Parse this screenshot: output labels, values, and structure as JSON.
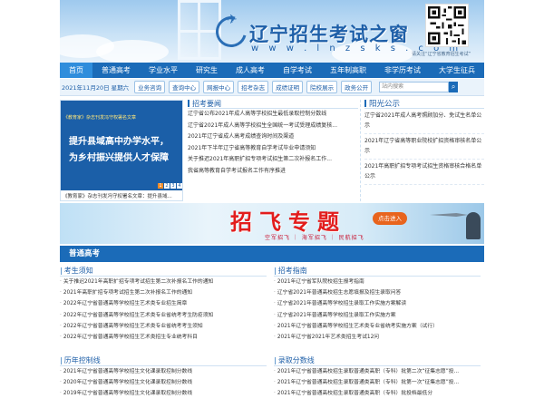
{
  "header": {
    "site_title": "辽宁招生考试之窗",
    "site_url": "w w w . l n z s k s . c o m",
    "qr_caption": "请关注“辽宁省教育招生考试”"
  },
  "main_nav": [
    "首页",
    "普通高考",
    "学业水平",
    "研究生",
    "成人高考",
    "自学考试",
    "五年制高职",
    "非学历考试",
    "大学生征兵"
  ],
  "subbar": {
    "date": "2021年11月20日 星期六",
    "buttons": [
      "业务咨询",
      "查询中心",
      "网报中心",
      "招考杂志",
      "成绩证明",
      "院校展示",
      "政务公开"
    ],
    "search_placeholder": "站内搜索",
    "search_icon": "search-icon"
  },
  "promo": {
    "header": "《教育家》杂志刊发冯守权署名文章",
    "headline1": "提升县域高中办学水平，",
    "headline2": "为乡村振兴提供人才保障",
    "dots": [
      "1",
      "2",
      "3",
      "4"
    ],
    "caption": "《教育家》杂志刊发冯守权署名文章：提升县域..."
  },
  "news": {
    "title": "招考要闻",
    "items": [
      "辽宁省公布2021年成人高等学校招生最低录取控制分数线",
      "辽宁省2021年成人高等学校招生全国统一考试受理成绩复核...",
      "2021年辽宁省成人高考成绩查询时间及渠道",
      "2021年下半年辽宁省高等教育自学考试毕业申请须知",
      "关于推迟2021年高职扩招专项考试招生第二次补报名工作...",
      "我省高等教育自学考试报名工作有序推进"
    ]
  },
  "sunshine": {
    "title": "阳光公示",
    "items": [
      "辽宁省2021年成人高考照顾加分、免试生名单公示",
      "2021年辽宁省高等职业院校扩招资格审核名单公示",
      "2021年高职扩招专项考试招生资格审核合格名单公示"
    ]
  },
  "banner": {
    "title": "招飞专题",
    "subtitle": "空军招飞 ｜ 海军招飞 ｜ 民航招飞",
    "cta": "点击进入"
  },
  "section": {
    "title": "普通高考",
    "columns": [
      {
        "title": "考生须知",
        "items": [
          "关于推迟2021年高职扩招专项考试招生第二次补报名工作的通知",
          "2021年高职扩招专项考试招生第二次补报名工作的通知",
          "2022年辽宁省普通高等学校招生艺术类专业招生简章",
          "2022年辽宁省普通高等学校招生艺术类专业省统考考生防疫须知",
          "2022年辽宁省普通高等学校招生艺术类专业省统考考生须知",
          "2022年辽宁省普通高等学校招生艺术类招生专业统考科目"
        ]
      },
      {
        "title": "招考指南",
        "items": [
          "2021年辽宁省军队院校招生报考指南",
          "辽宁省2021年普通高校招生志愿填报及招生录取问答",
          "辽宁省2021年普通高等学校招生录取工作实施方案解读",
          "辽宁省2021年普通高等学校招生录取工作实施方案",
          "2021年辽宁省普通高等学校招生艺术类专业省统考实施方案（试行）",
          "2021年辽宁省2021年艺术类招生考试12问"
        ]
      },
      {
        "title": "历年控制线",
        "items": [
          "2021年辽宁省普通高等学校招生文化课录取控制分数线",
          "2020年辽宁省普通高等学校招生文化课录取控制分数线",
          "2019年辽宁省普通高等学校招生文化课录取控制分数线"
        ]
      },
      {
        "title": "录取分数线",
        "items": [
          "2021年辽宁省普通高校招生录取普通类高职（专科）批第二次“征集志愿”投...",
          "2021年辽宁省普通高校招生录取普通类高职（专科）批第一次“征集志愿”投...",
          "2021年辽宁省普通高校招生录取普通类高职（专科）批投档最低分"
        ]
      }
    ]
  }
}
